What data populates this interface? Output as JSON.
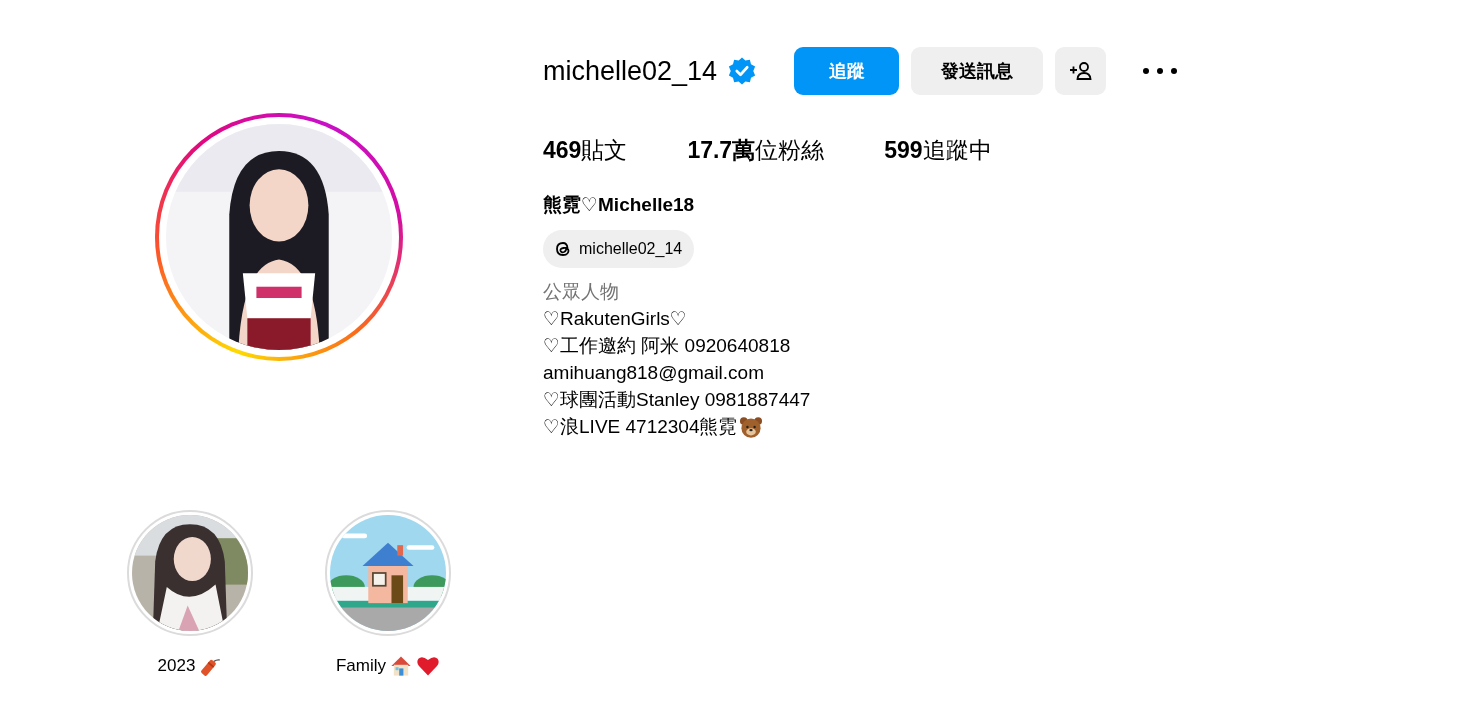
{
  "profile": {
    "username": "michelle02_14",
    "verified": true,
    "follow_button": "追蹤",
    "message_button": "發送訊息",
    "stats": [
      {
        "count": "469",
        "label": "貼文"
      },
      {
        "count": "17.7萬",
        "label": "位粉絲"
      },
      {
        "count": "599",
        "label": "追蹤中"
      }
    ],
    "display_name": "熊霓♡Michelle18",
    "threads_handle": "michelle02_14",
    "category": "公眾人物",
    "bio_lines": [
      "♡RakutenGirls♡",
      "♡工作邀約 阿米 0920640818",
      "amihuang818@gmail.com",
      "♡球團活動Stanley 0981887447",
      "♡浪LIVE 4712304熊霓"
    ]
  },
  "highlights": [
    {
      "title": "2023",
      "kind": "picture"
    },
    {
      "title": "Family",
      "kind": "picture"
    }
  ]
}
